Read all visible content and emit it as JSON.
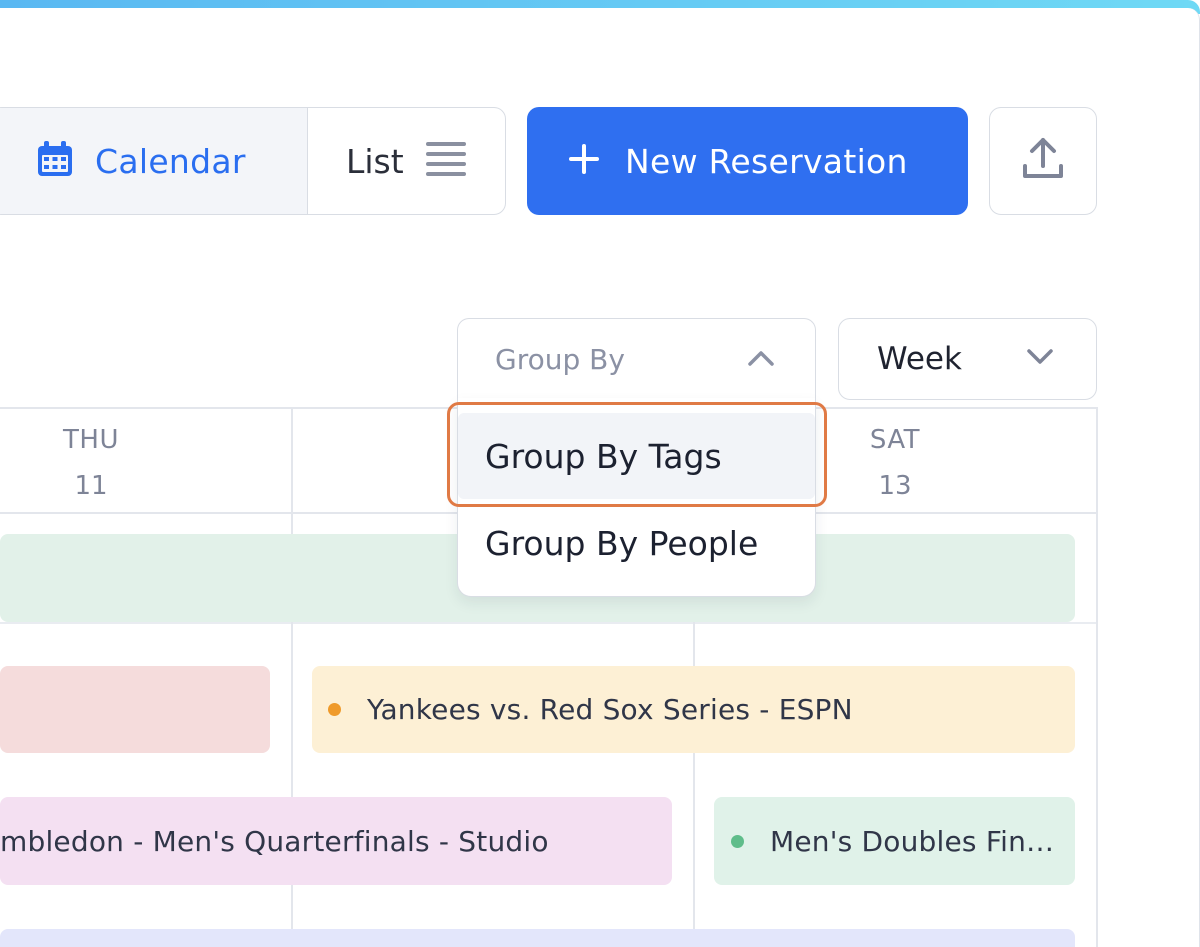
{
  "colors": {
    "accent": "#2f6ff0",
    "highlight": "#e07a45"
  },
  "toolbar": {
    "calendar_label": "Calendar",
    "calendar_icon": "calendar-icon",
    "list_label": "List",
    "list_icon": "list-lines-icon",
    "new_reservation_label": "New Reservation",
    "new_reservation_icon": "plus-icon",
    "export_icon": "upload-icon"
  },
  "filters": {
    "group_by_placeholder": "Group By",
    "group_by_icon": "chevron-up-icon",
    "view_range": "Week",
    "view_range_icon": "chevron-down-icon"
  },
  "dropdown": {
    "options": [
      {
        "label": "Group By Tags",
        "highlighted": true
      },
      {
        "label": "Group By People",
        "highlighted": false
      }
    ]
  },
  "calendar": {
    "days": [
      {
        "name": "THU",
        "date": "11"
      },
      {
        "name": "SAT",
        "date": "13"
      }
    ],
    "events": [
      {
        "title": "",
        "color": "#e2f1e9"
      },
      {
        "title": "",
        "color": "#f5dcdc"
      },
      {
        "title": "Yankees vs. Red Sox Series - ESPN",
        "color": "#fdf0d5",
        "dot": "#ef9a2a"
      },
      {
        "title": "mbledon - Men's Quarterfinals - Studio",
        "color": "#f4e0f2"
      },
      {
        "title": "Men's Doubles Fin…",
        "color": "#e0f2e9",
        "dot": "#5fbd8a"
      },
      {
        "title": "",
        "color": "#e3e6fb"
      }
    ]
  }
}
